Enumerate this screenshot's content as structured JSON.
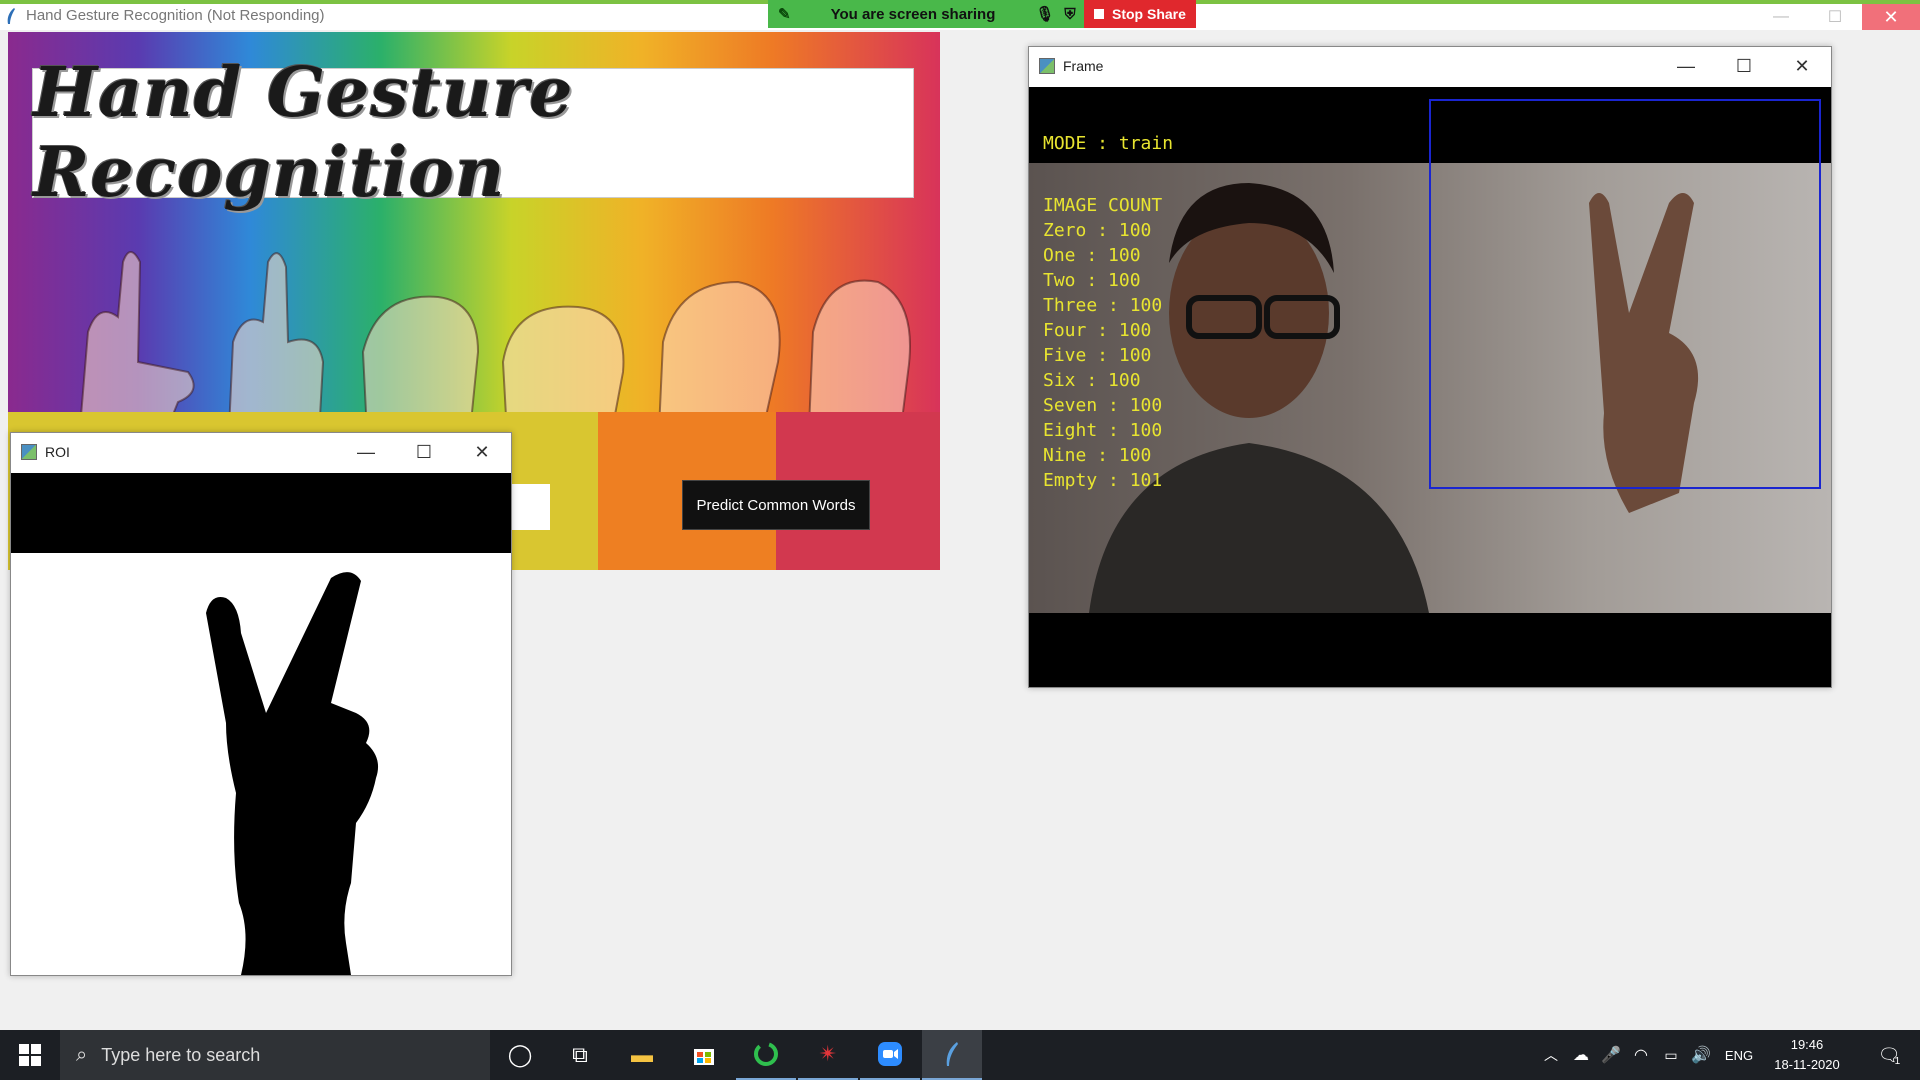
{
  "app_window": {
    "title": "Hand Gesture Recognition (Not Responding)",
    "controls": {
      "minimize": "—",
      "maximize": "☐",
      "close": "✕"
    }
  },
  "screen_share": {
    "status": "You are screen sharing",
    "stop_label": "Stop Share"
  },
  "banner": {
    "title": "Hand Gesture Recognition",
    "predict_button": "Predict Common Words"
  },
  "roi_window": {
    "title": "ROI",
    "controls": {
      "minimize": "—",
      "maximize": "☐",
      "close": "✕"
    }
  },
  "frame_window": {
    "title": "Frame",
    "controls": {
      "minimize": "—",
      "maximize": "☐",
      "close": "✕"
    },
    "mode_label": "MODE : train",
    "count_header": "IMAGE COUNT",
    "counts": [
      "Zero : 100",
      "One : 100",
      "Two : 100",
      "Three : 100",
      "Four : 100",
      "Five : 100",
      "Six : 100",
      "Seven : 100",
      "Eight : 100",
      "Nine : 100",
      "Empty : 101"
    ]
  },
  "taskbar": {
    "search_placeholder": "Type here to search",
    "language": "ENG",
    "time": "19:46",
    "date": "18-11-2020",
    "notification_count": "1",
    "icons": [
      "windows-start-icon",
      "search-icon",
      "cortana-icon",
      "task-view-icon",
      "file-explorer-icon",
      "store-icon",
      "browser-icon",
      "network-tool-icon",
      "zoom-icon",
      "python-feather-icon"
    ]
  },
  "colors": {
    "share_green": "#49b84a",
    "stop_red": "#e0282d",
    "overlay_text": "#e8e430",
    "roi_box": "#1a25d0"
  }
}
